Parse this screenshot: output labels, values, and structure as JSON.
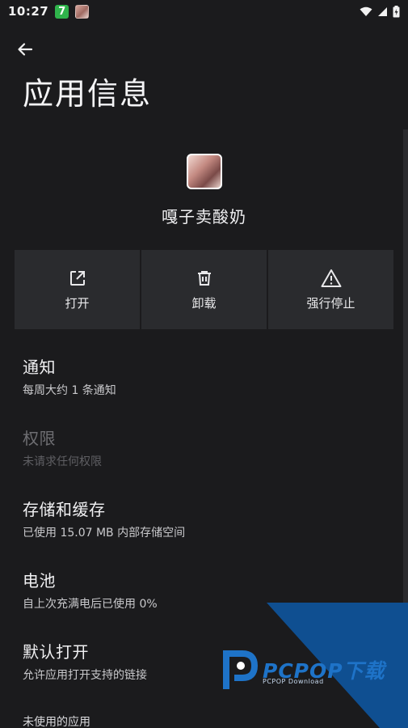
{
  "status_bar": {
    "time": "10:27",
    "badge_text": "7",
    "wifi_icon": "wifi-icon",
    "signal_icon": "signal-icon",
    "battery_icon": "battery-charging-icon"
  },
  "app_bar": {
    "back_icon": "back-arrow-icon"
  },
  "page": {
    "title": "应用信息"
  },
  "app": {
    "name": "嘎子卖酸奶"
  },
  "actions": [
    {
      "icon": "open-external-icon",
      "label": "打开"
    },
    {
      "icon": "trash-icon",
      "label": "卸载"
    },
    {
      "icon": "warning-icon",
      "label": "强行停止"
    }
  ],
  "settings": [
    {
      "title": "通知",
      "summary": "每周大约 1 条通知",
      "enabled": true
    },
    {
      "title": "权限",
      "summary": "未请求任何权限",
      "enabled": false
    },
    {
      "title": "存储和缓存",
      "summary": "已使用 15.07 MB 内部存储空间",
      "enabled": true
    },
    {
      "title": "电池",
      "summary": "自上次充满电后已使用 0%",
      "enabled": true
    },
    {
      "title": "默认打开",
      "summary": "允许应用打开支持的链接",
      "enabled": true
    }
  ],
  "section": {
    "unused_apps": "未使用的应用"
  },
  "watermark": {
    "brand": "PCPOP下载",
    "sub": "PCPOP Download"
  },
  "colors": {
    "background": "#1b1b1d",
    "surface": "#2a2b2e",
    "watermark_blue": "#0f4f91"
  }
}
